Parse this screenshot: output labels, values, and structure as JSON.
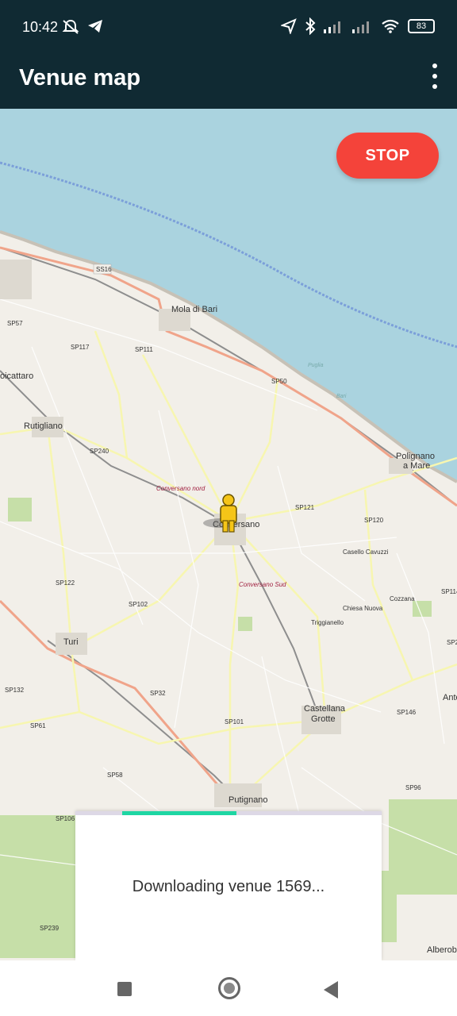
{
  "status_bar": {
    "time": "10:42",
    "battery": "83",
    "icons": [
      "mute-icon",
      "telegram-icon",
      "location-icon",
      "bluetooth-icon",
      "signal-icon",
      "signal-icon",
      "wifi-icon",
      "battery-icon"
    ]
  },
  "app_bar": {
    "title": "Venue map",
    "menu_icon": "overflow-menu-icon"
  },
  "map": {
    "stop_label": "STOP",
    "places": {
      "mola": "Mola di Bari",
      "rutigliano": "Rutigliano",
      "casamassima": "oicattaro",
      "conversano": "Conversano",
      "conversano_nord": "Conversano nord",
      "conversano_sud": "Conversano Sud",
      "polignano": "Polignano",
      "polignano2": "a Mare",
      "turi": "Turi",
      "castellana": "Castellana",
      "grotte": "Grotte",
      "putignano": "Putignano",
      "casello": "Casello Cavuzzi",
      "chiesa": "Chiesa Nuova",
      "cozzana": "Cozzana",
      "triggianello": "Triggianello",
      "alberobello": "Alberob",
      "anto": "Anto",
      "puglia": "Puglia",
      "bari": "Bari"
    },
    "roads": {
      "ss16": "SS16",
      "sp57": "SP57",
      "sp117": "SP117",
      "sp111": "SP111",
      "sp50": "SP50",
      "sp240": "SP240",
      "sp121": "SP121",
      "sp120": "SP120",
      "sp122": "SP122",
      "sp102": "SP102",
      "sp114": "SP114",
      "sp2": "SP2",
      "sp132": "SP132",
      "sp32": "SP32",
      "sp61": "SP61",
      "sp101": "SP101",
      "sp146": "SP146",
      "sp58": "SP58",
      "sp106": "SP106",
      "sp96": "SP96",
      "sp239": "SP239"
    },
    "marker_icon": "person-pegman-icon"
  },
  "dialog": {
    "message": "Downloading venue 1569...",
    "progress_indeterminate": true
  },
  "nav_bar": {
    "icons": [
      "recents-icon",
      "home-icon",
      "back-icon"
    ]
  }
}
